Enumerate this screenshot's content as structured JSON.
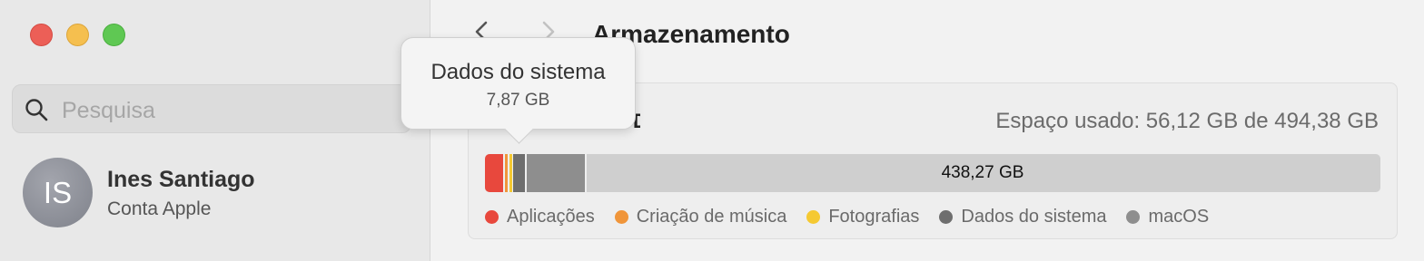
{
  "window": {
    "title": "Armazenamento"
  },
  "sidebar": {
    "search": {
      "placeholder": "Pesquisa",
      "value": ""
    },
    "account": {
      "initials": "IS",
      "name": "Ines Santiago",
      "subtitle": "Conta Apple"
    }
  },
  "storage": {
    "used_label": "Espaço usado: 56,12 GB de 494,38 GB",
    "free_label": "438,27 GB",
    "segments": [
      {
        "name": "Aplicações",
        "color": "#e8483d"
      },
      {
        "name": "Criação de música",
        "color": "#f0953a"
      },
      {
        "name": "Fotografias",
        "color": "#f5c932"
      },
      {
        "name": "Dados do sistema",
        "color": "#6e6e6e"
      },
      {
        "name": "macOS",
        "color": "#8e8e8e"
      }
    ],
    "legend": [
      "Aplicações",
      "Criação de música",
      "Fotografias",
      "Dados do sistema",
      "macOS"
    ]
  },
  "tooltip": {
    "title": "Dados do sistema",
    "value": "7,87 GB"
  },
  "icons": {
    "search": "search-icon",
    "back": "chevron-left-icon",
    "forward": "chevron-right-icon"
  }
}
